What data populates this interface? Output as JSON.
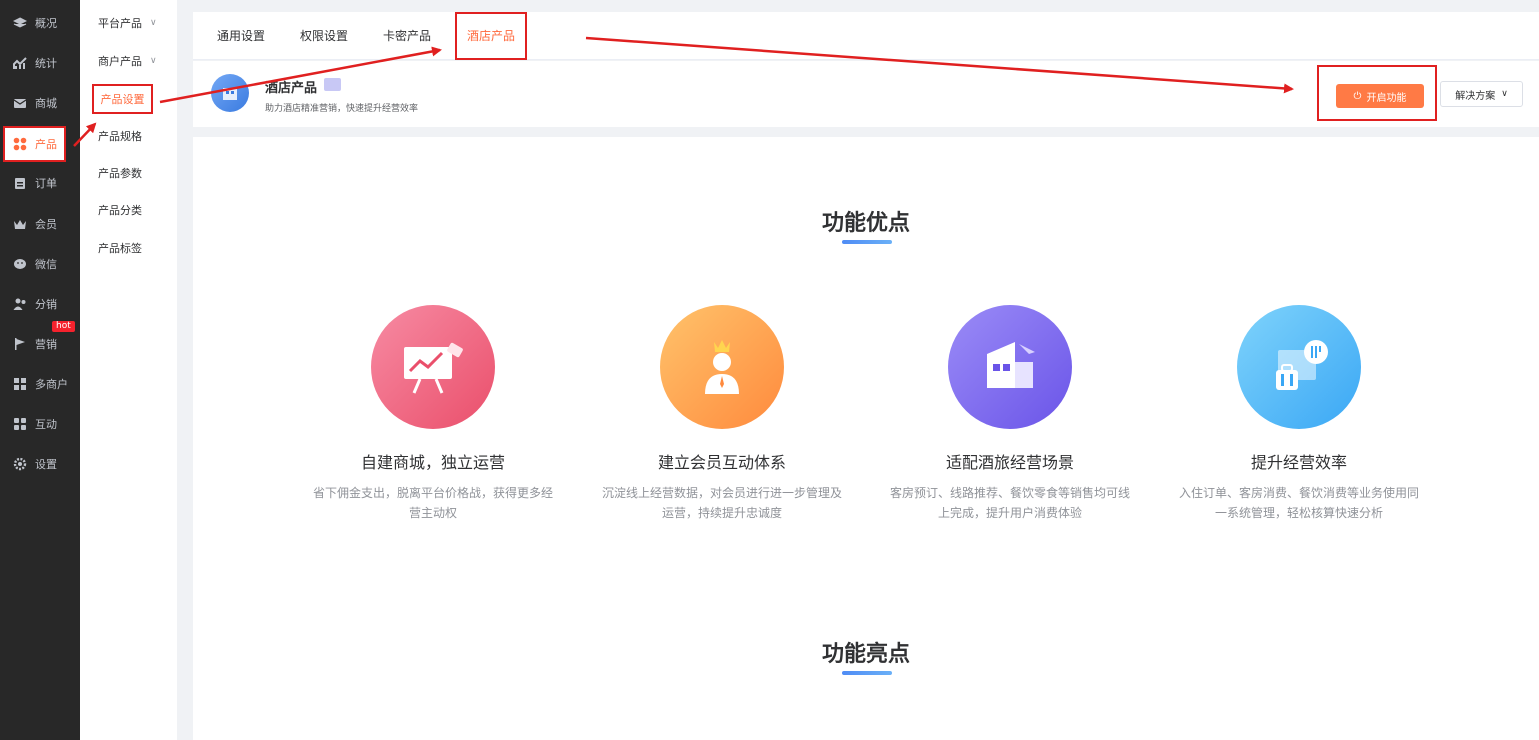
{
  "nav": {
    "items": [
      {
        "label": "概况",
        "icon": "layers-icon"
      },
      {
        "label": "统计",
        "icon": "chart-icon"
      },
      {
        "label": "商城",
        "icon": "mail-icon"
      },
      {
        "label": "产品",
        "icon": "grid-icon"
      },
      {
        "label": "订单",
        "icon": "clipboard-icon"
      },
      {
        "label": "会员",
        "icon": "crown-icon"
      },
      {
        "label": "微信",
        "icon": "wechat-icon"
      },
      {
        "label": "分销",
        "icon": "users-icon"
      },
      {
        "label": "营销",
        "icon": "flag-icon"
      },
      {
        "label": "多商户",
        "icon": "store-icon"
      },
      {
        "label": "互动",
        "icon": "apps-icon"
      },
      {
        "label": "设置",
        "icon": "gear-icon"
      }
    ],
    "hot_badge": "hot"
  },
  "subnav": {
    "items": [
      {
        "label": "平台产品"
      },
      {
        "label": "商户产品"
      },
      {
        "label": "产品设置"
      },
      {
        "label": "产品规格"
      },
      {
        "label": "产品参数"
      },
      {
        "label": "产品分类"
      },
      {
        "label": "产品标签"
      }
    ]
  },
  "tabs": [
    {
      "label": "通用设置"
    },
    {
      "label": "权限设置"
    },
    {
      "label": "卡密产品"
    },
    {
      "label": "酒店产品"
    }
  ],
  "header": {
    "title": "酒店产品",
    "subtitle": "助力酒店精准营销，快速提升经营效率",
    "enable_label": "开启功能",
    "solution_label": "解决方案"
  },
  "main": {
    "advantages_title": "功能优点",
    "highlights_title": "功能亮点",
    "features": [
      {
        "title": "自建商城，独立运营",
        "desc": "省下佣金支出，脱离平台价格战，获得更多经营主动权",
        "icon": "presentation-icon"
      },
      {
        "title": "建立会员互动体系",
        "desc": "沉淀线上经营数据，对会员进行进一步管理及运营，持续提升忠诚度",
        "icon": "member-icon"
      },
      {
        "title": "适配酒旅经营场景",
        "desc": "客房预订、线路推荐、餐饮零食等销售均可线上完成，提升用户消费体验",
        "icon": "hotel-icon"
      },
      {
        "title": "提升经营效率",
        "desc": "入住订单、客房消费、餐饮消费等业务使用同一系统管理，轻松核算快速分析",
        "icon": "luggage-icon"
      }
    ]
  },
  "colors": {
    "accent": "#ff6a3d",
    "annotation_red": "#e02020",
    "nav_bg": "#282828"
  }
}
